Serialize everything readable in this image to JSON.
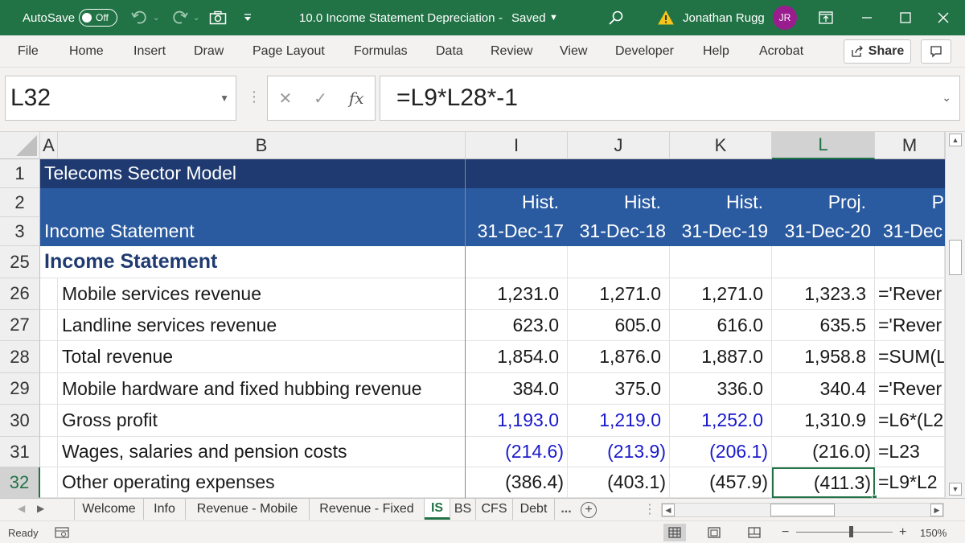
{
  "window": {
    "autosave_label": "AutoSave",
    "autosave_state": "Off",
    "title": "10.0 Income Statement Depreciation",
    "saved_state": "Saved",
    "user_name": "Jonathan Rugg",
    "user_initials": "JR"
  },
  "ribbon": {
    "tabs": [
      "File",
      "Home",
      "Insert",
      "Draw",
      "Page Layout",
      "Formulas",
      "Data",
      "Review",
      "View",
      "Developer",
      "Help",
      "Acrobat"
    ],
    "share_label": "Share"
  },
  "formula_bar": {
    "name_box": "L32",
    "formula": "=L9*L28*-1",
    "fx_label": "fx"
  },
  "grid": {
    "columns": [
      "A",
      "B",
      "I",
      "J",
      "K",
      "L",
      "M"
    ],
    "selected_column": "L",
    "rows": [
      {
        "num": "1",
        "label": "Telecoms Sector Model",
        "values": [
          "",
          "",
          "",
          "",
          ""
        ]
      },
      {
        "num": "2",
        "label": "",
        "values": [
          "Hist.",
          "Hist.",
          "Hist.",
          "Proj.",
          "P"
        ]
      },
      {
        "num": "3",
        "label": "Income Statement",
        "values": [
          "31-Dec-17",
          "31-Dec-18",
          "31-Dec-19",
          "31-Dec-20",
          "31-Dec"
        ]
      },
      {
        "num": "25",
        "label": "Income Statement",
        "values": [
          "",
          "",
          "",
          "",
          ""
        ]
      },
      {
        "num": "26",
        "label": "Mobile services revenue",
        "values": [
          "1,231.0",
          "1,271.0",
          "1,271.0",
          "1,323.3",
          "='Rever"
        ]
      },
      {
        "num": "27",
        "label": "Landline services revenue",
        "values": [
          "623.0",
          "605.0",
          "616.0",
          "635.5",
          "='Rever"
        ]
      },
      {
        "num": "28",
        "label": "Total revenue",
        "values": [
          "1,854.0",
          "1,876.0",
          "1,887.0",
          "1,958.8",
          "=SUM(L"
        ]
      },
      {
        "num": "29",
        "label": "Mobile hardware and fixed hubbing revenue",
        "values": [
          "384.0",
          "375.0",
          "336.0",
          "340.4",
          "='Rever"
        ]
      },
      {
        "num": "30",
        "label": "Gross profit",
        "values": [
          "1,193.0",
          "1,219.0",
          "1,252.0",
          "1,310.9",
          "=L6*(L2"
        ]
      },
      {
        "num": "31",
        "label": "Wages, salaries and pension costs",
        "values": [
          "(214.6)",
          "(213.9)",
          "(206.1)",
          "(216.0)",
          "=L23"
        ]
      },
      {
        "num": "32",
        "label": "Other operating expenses",
        "values": [
          "(386.4)",
          "(403.1)",
          "(457.9)",
          "(411.3)",
          "=L9*L2"
        ]
      }
    ],
    "selected_row": "32"
  },
  "sheets": {
    "tabs": [
      "Welcome",
      "Info",
      "Revenue - Mobile",
      "Revenue - Fixed",
      "IS",
      "BS",
      "CFS",
      "Debt"
    ],
    "active": "IS",
    "more_label": "..."
  },
  "status": {
    "ready": "Ready",
    "zoom": "150%"
  },
  "colors": {
    "excel_green": "#217346",
    "header_dark_blue": "#1f3a70",
    "header_blue": "#2a5aa0",
    "input_blue": "#1a1acc",
    "avatar_purple": "#9a1d8f"
  }
}
